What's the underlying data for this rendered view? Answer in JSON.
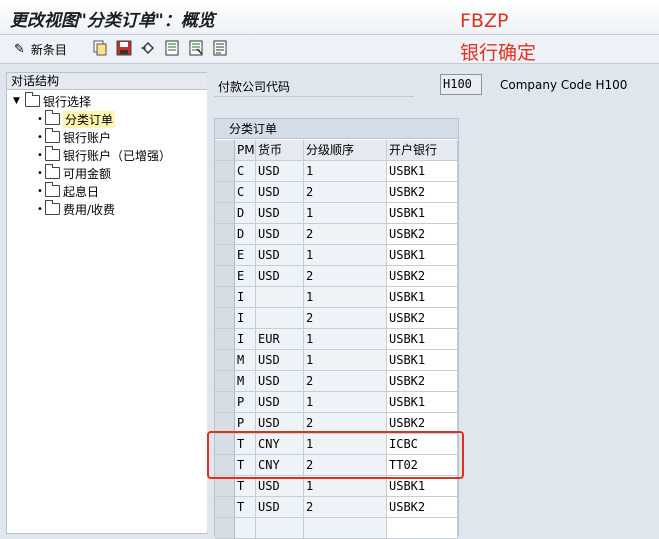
{
  "window": {
    "title": "更改视图\"分类订单\"：概览"
  },
  "toolbar": {
    "new_entries_label": "新条目",
    "icons": [
      "pencil-icon",
      "copy-icon",
      "save-icon",
      "undo-icon",
      "select-all-icon",
      "deselect-icon",
      "select-block-icon"
    ]
  },
  "annotation": {
    "line1": "FBZP",
    "line2": "银行确定"
  },
  "tree": {
    "title": "对话结构",
    "root": "银行选择",
    "children": [
      "分类订单",
      "银行账户",
      "银行账户（已增强）",
      "可用金额",
      "起息日",
      "费用/收费"
    ],
    "selected": "分类订单"
  },
  "company": {
    "label": "付款公司代码",
    "code": "H100",
    "description": "Company Code H100"
  },
  "table": {
    "caption": "分类订单",
    "columns": [
      "PM",
      "货币",
      "分级顺序",
      "开户银行"
    ],
    "rows": [
      [
        "C",
        "USD",
        "1",
        "USBK1"
      ],
      [
        "C",
        "USD",
        "2",
        "USBK2"
      ],
      [
        "D",
        "USD",
        "1",
        "USBK1"
      ],
      [
        "D",
        "USD",
        "2",
        "USBK2"
      ],
      [
        "E",
        "USD",
        "1",
        "USBK1"
      ],
      [
        "E",
        "USD",
        "2",
        "USBK2"
      ],
      [
        "I",
        "",
        "1",
        "USBK1"
      ],
      [
        "I",
        "",
        "2",
        "USBK2"
      ],
      [
        "I",
        "EUR",
        "1",
        "USBK1"
      ],
      [
        "M",
        "USD",
        "1",
        "USBK1"
      ],
      [
        "M",
        "USD",
        "2",
        "USBK2"
      ],
      [
        "P",
        "USD",
        "1",
        "USBK1"
      ],
      [
        "P",
        "USD",
        "2",
        "USBK2"
      ],
      [
        "T",
        "CNY",
        "1",
        "ICBC"
      ],
      [
        "T",
        "CNY",
        "2",
        "TT02"
      ],
      [
        "T",
        "USD",
        "1",
        "USBK1"
      ],
      [
        "T",
        "USD",
        "2",
        "USBK2"
      ]
    ]
  },
  "colors": {
    "annotation_red": "#e0301e",
    "selected_yellow": "#fff6b0"
  }
}
